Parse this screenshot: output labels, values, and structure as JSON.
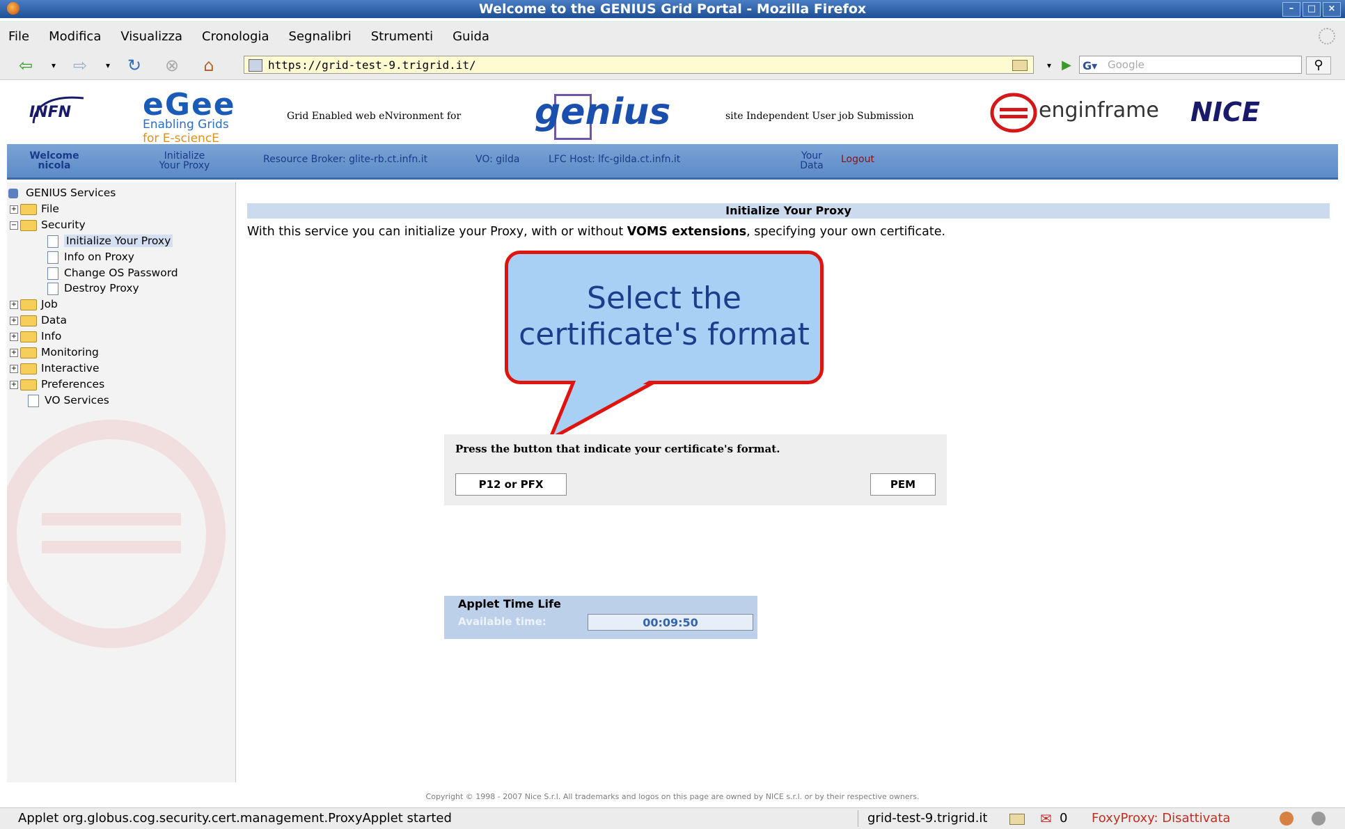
{
  "window": {
    "title": "Welcome to the GENIUS Grid Portal - Mozilla Firefox"
  },
  "menu": [
    "File",
    "Modifica",
    "Visualizza",
    "Cronologia",
    "Segnalibri",
    "Strumenti",
    "Guida"
  ],
  "address": {
    "url": "https://grid-test-9.trigrid.it/",
    "search_placeholder": "Google"
  },
  "header": {
    "infn": "INFN",
    "egee": "eGee",
    "egee_sub1": "Enabling Grids",
    "egee_sub2": "for E-sciencE",
    "genius_acronym_1": "Grid Enabled web eNvironment for",
    "genius_logo": "genius",
    "genius_acronym_2": "site Independent User job Submission",
    "enginframe": "enginframe",
    "nice": "NICE"
  },
  "portal_nav": {
    "welcome": "Welcome",
    "user": "nicola",
    "init1": "Initialize",
    "init2": "Your Proxy",
    "rb": "Resource Broker: glite-rb.ct.infn.it",
    "vo": "VO: gilda",
    "lfc": "LFC Host: lfc-gilda.ct.infn.it",
    "data1": "Your",
    "data2": "Data",
    "logout": "Logout"
  },
  "sidebar": {
    "root": "GENIUS Services",
    "items": [
      "File",
      "Security",
      "Initialize Your Proxy",
      "Info on Proxy",
      "Change OS Password",
      "Destroy Proxy",
      "Job",
      "Data",
      "Info",
      "Monitoring",
      "Interactive",
      "Preferences",
      "VO Services"
    ]
  },
  "content": {
    "title": "Initialize Your Proxy",
    "desc_pre": "With this service you can initialize your Proxy, with or without ",
    "desc_bold": "VOMS extensions",
    "desc_post": ", specifying your own certificate.",
    "callout1": "Select the",
    "callout2": "certificate's format",
    "cert_label": "Press the button that indicate your certificate's format.",
    "btn_p12": "P12 or PFX",
    "btn_pem": "PEM",
    "applet_title": "Applet Time Life",
    "applet_label": "Available time:",
    "applet_time": "00:09:50"
  },
  "footer": {
    "copyright": "Copyright © 1998 - 2007 Nice S.r.l. All trademarks and logos on this page are owned by NICE s.r.l. or by their respective owners.",
    "status_left": "Applet org.globus.cog.security.cert.management.ProxyApplet started",
    "status_host": "grid-test-9.trigrid.it",
    "status_mail": "0",
    "foxy": "FoxyProxy: Disattivata"
  },
  "colors": {
    "accent": "#5c8bc7",
    "callout_border": "#e0140f",
    "callout_fill": "#a8d0f4"
  }
}
